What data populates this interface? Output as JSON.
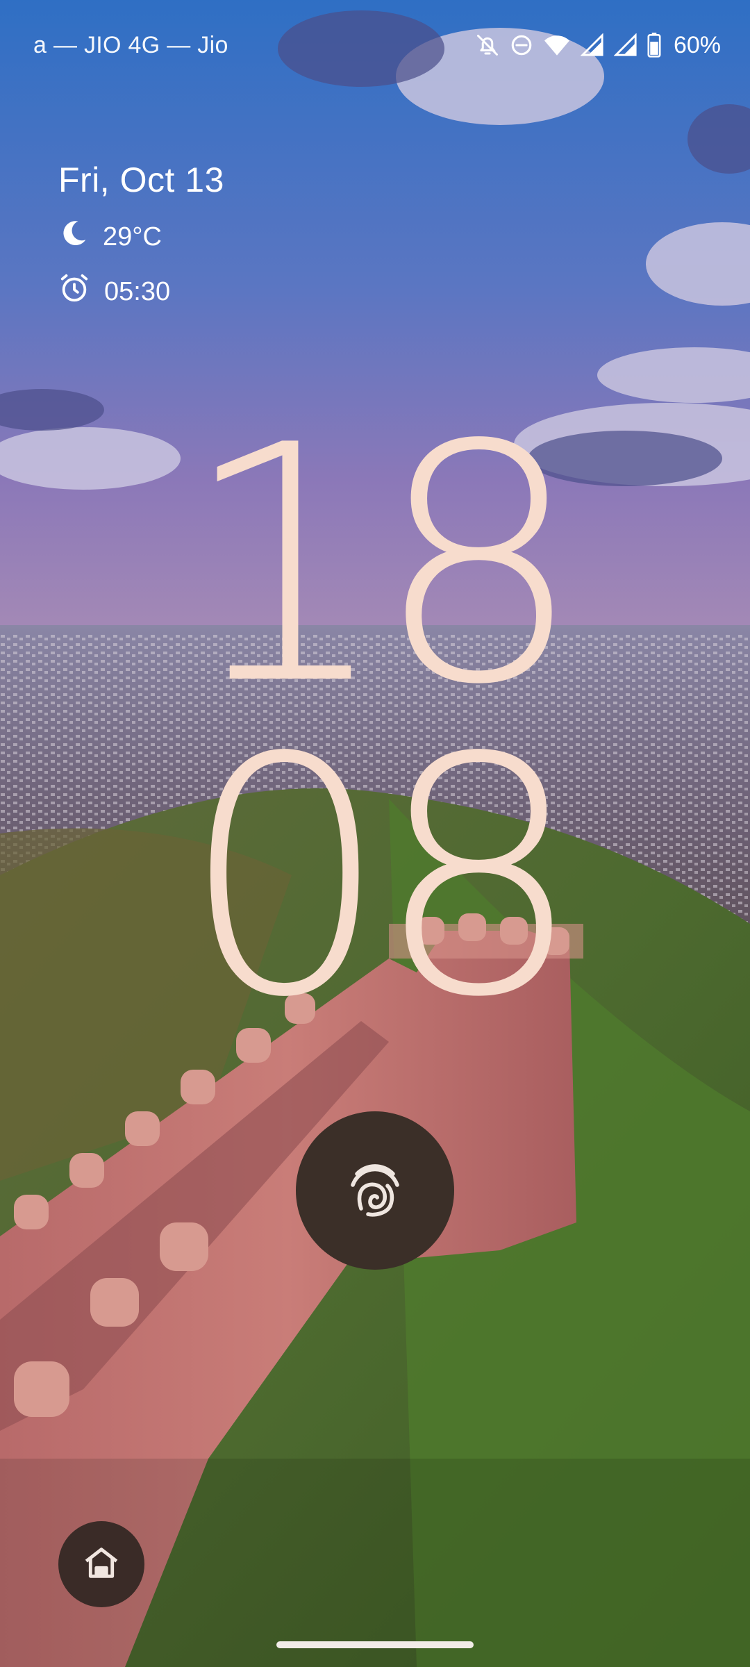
{
  "status_bar": {
    "carrier": "a — JIO 4G — Jio",
    "battery_percent": "60%",
    "icons": [
      "bell-off-icon",
      "do-not-disturb-icon",
      "wifi-icon",
      "cell-signal-icon",
      "cell-signal-icon",
      "battery-icon"
    ]
  },
  "smartspace": {
    "date": "Fri, Oct 13",
    "weather": {
      "icon": "moon-icon",
      "temperature": "29°C"
    },
    "alarm": {
      "icon": "alarm-clock-icon",
      "time": "05:30"
    }
  },
  "clock": {
    "hours": "18",
    "minutes": "08",
    "color": "#f7dccd"
  },
  "lock_actions": {
    "fingerprint_icon": "fingerprint-icon",
    "home_icon": "home-icon"
  },
  "colors": {
    "clock": "#f7dccd",
    "fingerprint_bg": "#3b2f28",
    "home_bg": "#3a2b27",
    "nav_handle": "#f2ece8"
  }
}
